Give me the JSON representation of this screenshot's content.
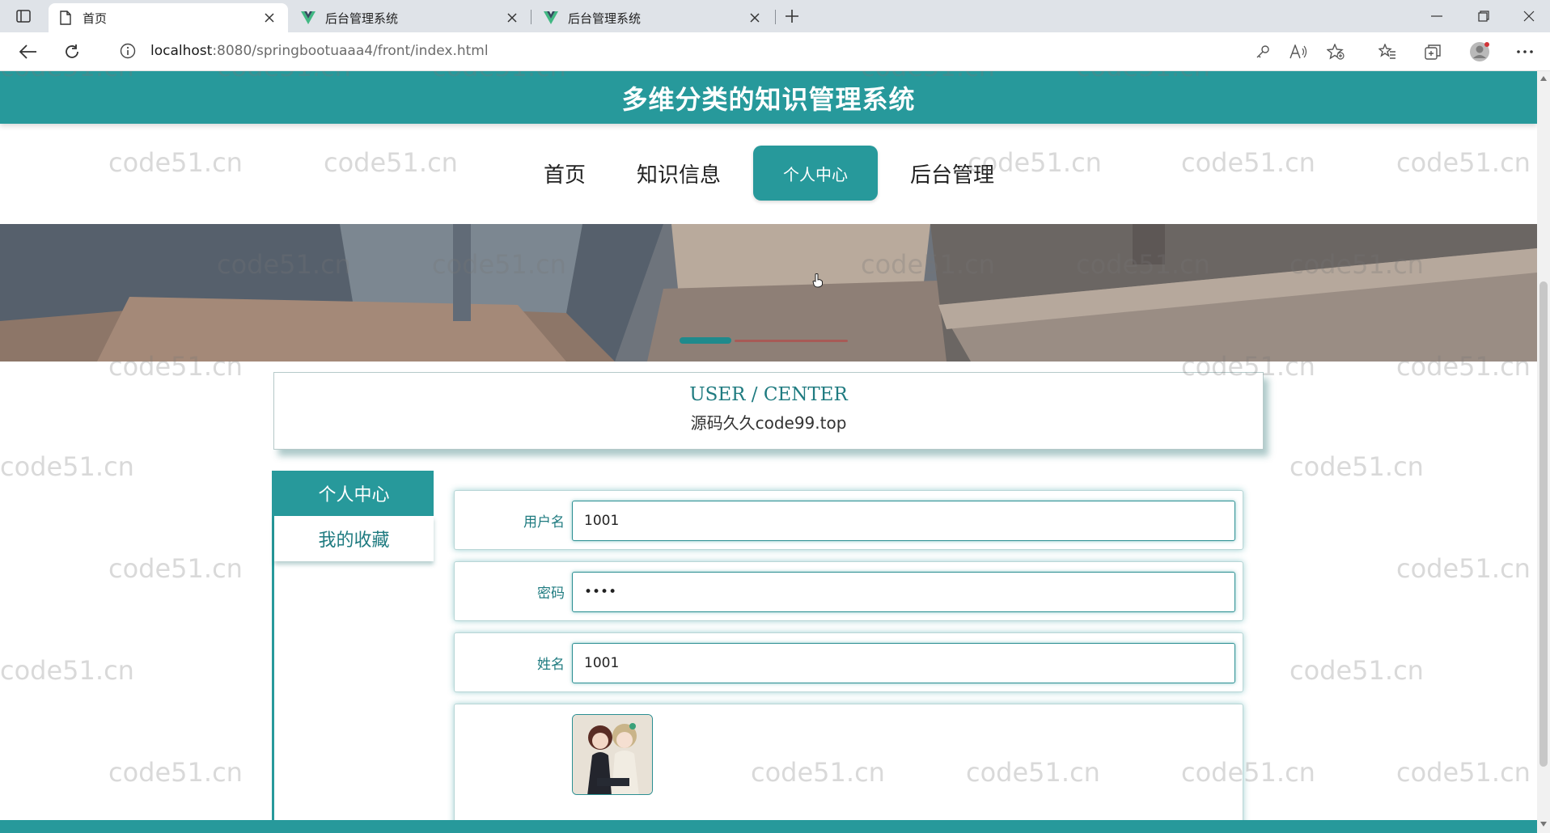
{
  "browser": {
    "tabs": [
      {
        "title": "首页",
        "active": true
      },
      {
        "title": "后台管理系统",
        "active": false
      },
      {
        "title": "后台管理系统",
        "active": false
      }
    ],
    "url_host": "localhost",
    "url_path": ":8080/springbootuaaa4/front/index.html",
    "colors": {
      "tab_bar": "#dfe3e8",
      "vue_logo": "#41b883"
    }
  },
  "site": {
    "title": "多维分类的知识管理系统",
    "nav": [
      "首页",
      "知识信息",
      "个人中心",
      "后台管理"
    ],
    "active_nav": "个人中心",
    "accent_color": "#27999b"
  },
  "banner": {
    "carousel_active_index": 0
  },
  "user_center": {
    "title_en": "USER / CENTER",
    "title_cn": "源码久久code99.top"
  },
  "side_menu": {
    "items": [
      "个人中心",
      "我的收藏"
    ],
    "active": "个人中心"
  },
  "form": {
    "username_label": "用户名",
    "username_value": "1001",
    "password_label": "密码",
    "password_value": "••••",
    "name_label": "姓名",
    "name_value": "1001"
  },
  "watermark_text": "code51.cn"
}
